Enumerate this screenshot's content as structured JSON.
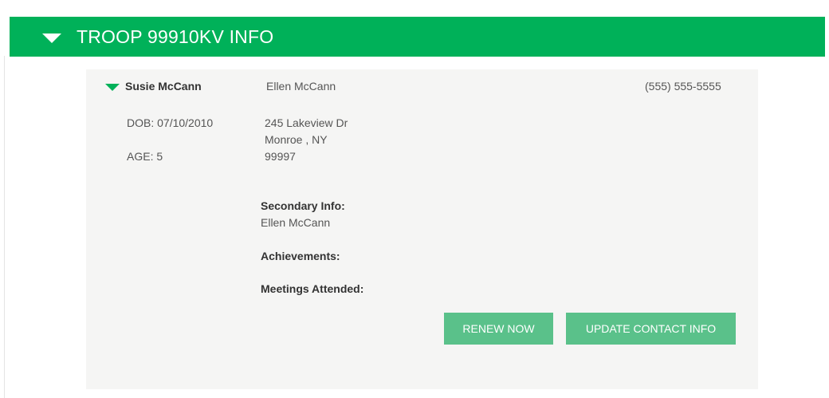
{
  "header": {
    "title": "TROOP 99910KV INFO"
  },
  "member": {
    "name": "Susie McCann",
    "dob": "DOB: 07/10/2010",
    "age": "AGE: 5",
    "parent_name": "Ellen McCann",
    "phone": "(555) 555-5555",
    "address_line1": "245 Lakeview Dr",
    "address_line2": "Monroe , NY",
    "address_line3": "99997",
    "secondary_info_label": "Secondary Info:",
    "secondary_info_value": "Ellen McCann",
    "achievements_label": "Achievements:",
    "meetings_label": "Meetings Attended:"
  },
  "actions": {
    "renew_label": "RENEW NOW",
    "update_label": "UPDATE CONTACT INFO"
  },
  "colors": {
    "brand_green": "#00b159",
    "button_green": "#5ac18a",
    "card_bg": "#f5f5f4"
  },
  "icons": {
    "header_toggle": "caret-down-icon",
    "member_toggle": "caret-down-icon"
  }
}
